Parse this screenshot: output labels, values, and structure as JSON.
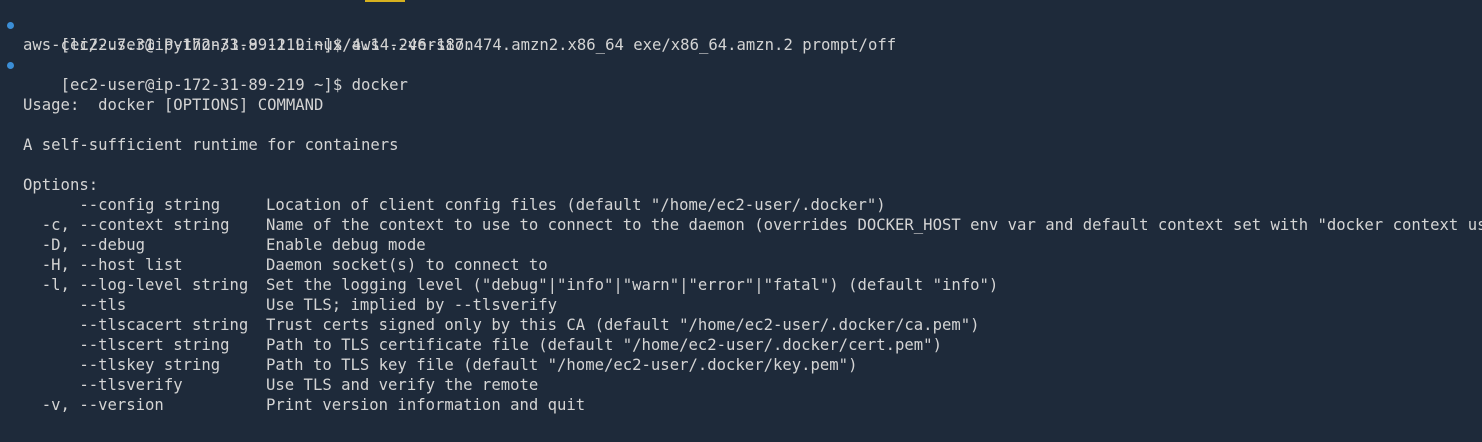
{
  "terminal": {
    "prompt_marker_color": "#3b8ed6",
    "session": [
      {
        "type": "prompt",
        "text": "[ec2-user@ip-172-31-89-219 ~]$ aws --version"
      },
      {
        "type": "output",
        "text": "aws-cli/2.7.31 Python/3.9.11 Linux/4.14.246-187.474.amzn2.x86_64 exe/x86_64.amzn.2 prompt/off"
      },
      {
        "type": "prompt",
        "text": "[ec2-user@ip-172-31-89-219 ~]$ docker"
      },
      {
        "type": "blank",
        "text": ""
      },
      {
        "type": "output",
        "text": "Usage:  docker [OPTIONS] COMMAND"
      },
      {
        "type": "blank",
        "text": ""
      },
      {
        "type": "output",
        "text": "A self-sufficient runtime for containers"
      },
      {
        "type": "blank",
        "text": ""
      },
      {
        "type": "output",
        "text": "Options:"
      }
    ],
    "options": [
      {
        "flag": "      --config string",
        "desc": "Location of client config files (default \"/home/ec2-user/.docker\")"
      },
      {
        "flag": "  -c, --context string",
        "desc": "Name of the context to use to connect to the daemon (overrides DOCKER_HOST env var and default context set with \"docker context use\")"
      },
      {
        "flag": "  -D, --debug",
        "desc": "Enable debug mode"
      },
      {
        "flag": "  -H, --host list",
        "desc": "Daemon socket(s) to connect to"
      },
      {
        "flag": "  -l, --log-level string",
        "desc": "Set the logging level (\"debug\"|\"info\"|\"warn\"|\"error\"|\"fatal\") (default \"info\")"
      },
      {
        "flag": "      --tls",
        "desc": "Use TLS; implied by --tlsverify"
      },
      {
        "flag": "      --tlscacert string",
        "desc": "Trust certs signed only by this CA (default \"/home/ec2-user/.docker/ca.pem\")"
      },
      {
        "flag": "      --tlscert string",
        "desc": "Path to TLS certificate file (default \"/home/ec2-user/.docker/cert.pem\")"
      },
      {
        "flag": "      --tlskey string",
        "desc": "Path to TLS key file (default \"/home/ec2-user/.docker/key.pem\")"
      },
      {
        "flag": "      --tlsverify",
        "desc": "Use TLS and verify the remote"
      },
      {
        "flag": "  -v, --version",
        "desc": "Print version information and quit"
      }
    ]
  }
}
